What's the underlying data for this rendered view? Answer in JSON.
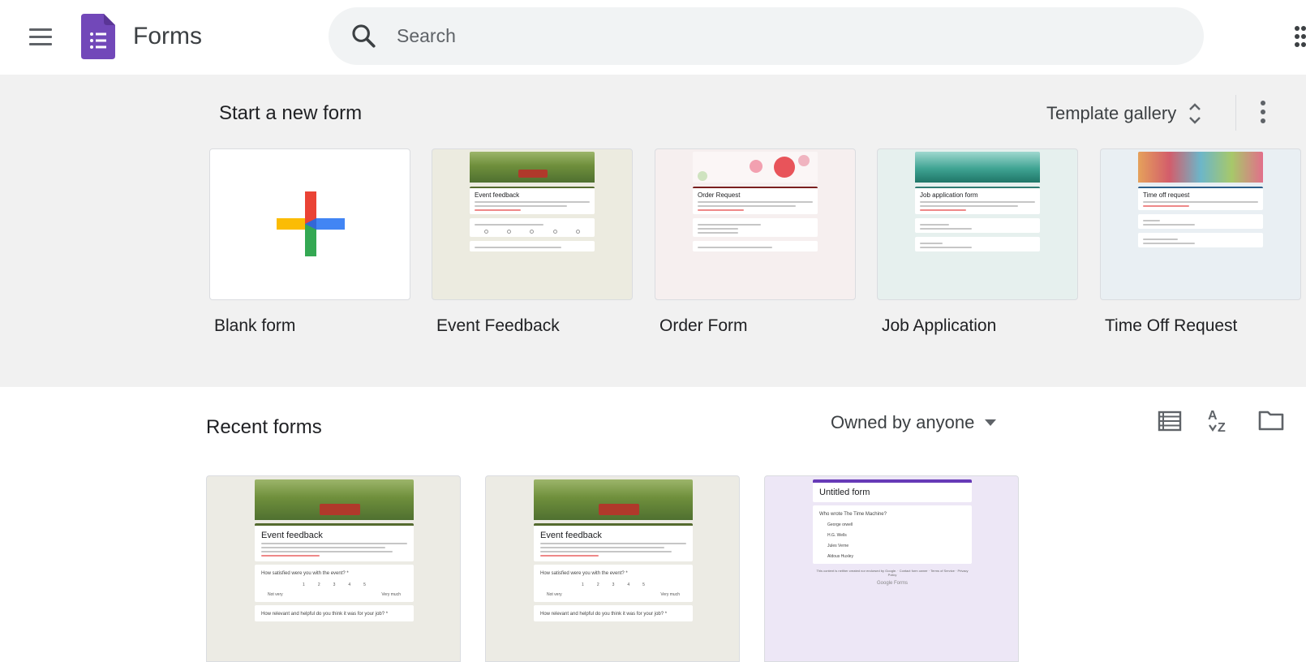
{
  "header": {
    "app_title": "Forms",
    "search_placeholder": "Search"
  },
  "templates": {
    "heading": "Start a new form",
    "gallery_label": "Template gallery",
    "items": [
      {
        "label": "Blank form"
      },
      {
        "label": "Event Feedback",
        "preview_title": "Event feedback"
      },
      {
        "label": "Order Form",
        "preview_title": "Order Request"
      },
      {
        "label": "Job Application",
        "preview_title": "Job application form"
      },
      {
        "label": "Time Off Request",
        "preview_title": "Time off request"
      }
    ]
  },
  "recent": {
    "heading": "Recent forms",
    "owner_filter": "Owned by anyone",
    "forms": [
      {
        "preview_title": "Event feedback",
        "question_1": "How satisfied were you with the event? *",
        "scale": [
          "1",
          "2",
          "3",
          "4",
          "5"
        ],
        "scale_low": "Not very",
        "scale_high": "Very much",
        "question_2": "How relevant and helpful do you think it was for your job? *"
      },
      {
        "preview_title": "Event feedback",
        "question_1": "How satisfied were you with the event? *",
        "scale": [
          "1",
          "2",
          "3",
          "4",
          "5"
        ],
        "scale_low": "Not very",
        "scale_high": "Very much",
        "question_2": "How relevant and helpful do you think it was for your job? *"
      },
      {
        "preview_title": "Untitled form",
        "question_1": "Who wrote The Time Machine?",
        "options": [
          "George orwell",
          "H.G. Wells",
          "Jules Verne",
          "Aldous Huxley"
        ],
        "footer": "This content is neither created nor endorsed by Google. · Contact form owner · Terms of Service · Privacy Policy",
        "brand": "Google Forms"
      }
    ]
  },
  "colors": {
    "forms_purple": "#7248b9",
    "header_bg": "#ffffff",
    "template_bg": "#f1f1f1",
    "search_bg": "#f1f3f4"
  }
}
